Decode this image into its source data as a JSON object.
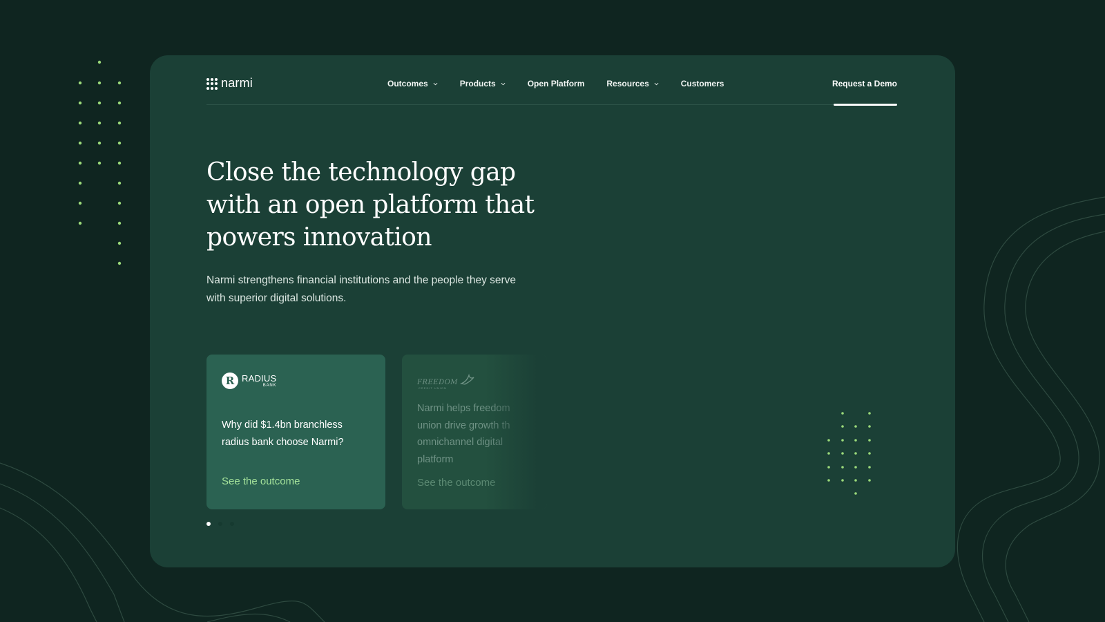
{
  "brand": {
    "name": "narmi"
  },
  "nav": {
    "items": [
      {
        "label": "Outcomes",
        "has_dropdown": true
      },
      {
        "label": "Products",
        "has_dropdown": true
      },
      {
        "label": "Open Platform",
        "has_dropdown": false
      },
      {
        "label": "Resources",
        "has_dropdown": true
      },
      {
        "label": "Customers",
        "has_dropdown": false
      }
    ],
    "cta": "Request a Demo"
  },
  "hero": {
    "title": "Close the technology gap with an open platform that powers innovation",
    "subtitle": "Narmi strengthens financial institutions and the people they serve with superior digital solutions."
  },
  "cases": [
    {
      "logo_name": "RADIUS",
      "logo_sub": "BANK",
      "question": "Why did $1.4bn branchless radius bank choose Narmi?",
      "link": "See the outcome"
    },
    {
      "logo_name": "FREEDOM",
      "logo_sub": "CREDIT UNION",
      "question_lines": [
        "Narmi helps freedom",
        "union drive growth th",
        "omnichannel digital",
        "platform"
      ],
      "link": "See the outcome"
    }
  ],
  "carousel": {
    "active": 1,
    "count": 3
  },
  "colors": {
    "page_bg": "#0f2520",
    "card_bg": "#1b4036",
    "case_active": "#2b6252",
    "accent_link": "#a4e29a",
    "dot_accent": "#9bd97a"
  }
}
